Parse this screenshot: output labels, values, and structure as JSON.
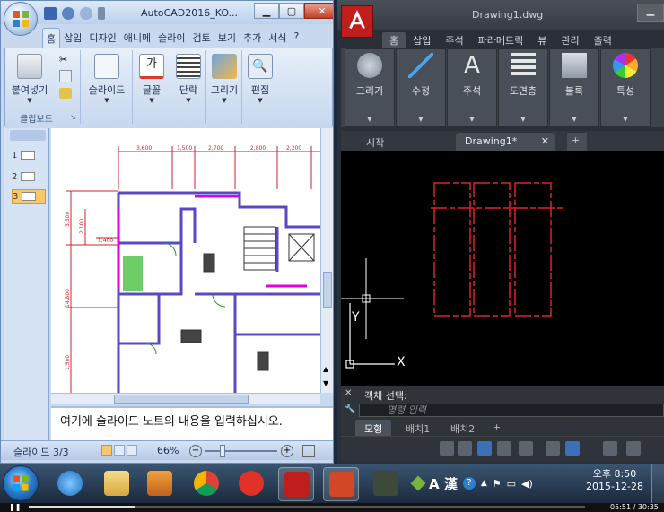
{
  "powerpoint": {
    "title": "AutoCAD2016_KO...",
    "tabs": [
      "홈",
      "삽입",
      "디자인",
      "애니메",
      "슬라이",
      "검토",
      "보기",
      "추가",
      "서식"
    ],
    "active_tab": "홈",
    "ribbon_groups": [
      {
        "label": "붙여넣기",
        "icon": "paste-icon"
      },
      {
        "label": "슬라이드",
        "icon": "slides-icon"
      },
      {
        "label": "글꼴",
        "icon": "font-icon"
      },
      {
        "label": "단락",
        "icon": "paragraph-icon"
      },
      {
        "label": "그리기",
        "icon": "drawing-icon"
      },
      {
        "label": "편집",
        "icon": "editing-icon"
      }
    ],
    "clipboard_label": "클립보드",
    "slide_thumbs": [
      "1",
      "2",
      "3"
    ],
    "selected_slide": "3",
    "notes_text": "여기에 슬라이드 노트의 내용을 입력하십시오.",
    "status": {
      "slide_counter": "슬라이드 3/3",
      "zoom": "66%"
    },
    "plan_dims": [
      "3,600",
      "1,500",
      "2,700",
      "2,800",
      "2,200"
    ],
    "plan_side_dims": [
      "3,600",
      "2,100",
      "1,400",
      "14,800",
      "1,500"
    ]
  },
  "autocad": {
    "title": "Drawing1.dwg",
    "tabs": [
      "홈",
      "삽입",
      "주석",
      "파라메트릭",
      "뷰",
      "관리",
      "출력"
    ],
    "active_tab": "홈",
    "panels": [
      {
        "label": "그리기",
        "icon": "draw-icon"
      },
      {
        "label": "수정",
        "icon": "modify-icon"
      },
      {
        "label": "주석",
        "icon": "annotation-icon"
      },
      {
        "label": "도면층",
        "icon": "layers-icon"
      },
      {
        "label": "블록",
        "icon": "block-icon"
      },
      {
        "label": "특성",
        "icon": "properties-icon"
      }
    ],
    "file_tabs": [
      {
        "label": "시작"
      },
      {
        "label": "Drawing1*"
      }
    ],
    "command_prompt": "객체 선택:",
    "command_placeholder": "명령 입력",
    "layout_tabs": [
      "모형",
      "배치1",
      "배치2"
    ],
    "active_layout": "모형",
    "ucs_x_label": "X",
    "ucs_y_label": "Y",
    "colors": {
      "drawing_line": "#e0222a",
      "background": "#000000"
    }
  },
  "taskbar": {
    "apps": [
      "windows-explorer",
      "internet-explorer",
      "file-explorer",
      "media-player",
      "chrome",
      "app-red",
      "autocad",
      "powerpoint",
      "camtasia"
    ],
    "lang_text": "A 漢",
    "time": "오후 8:50",
    "date": "2015-12-28"
  },
  "player": {
    "elapsed": "05:51",
    "total": "30:35",
    "progress": 0.19
  }
}
